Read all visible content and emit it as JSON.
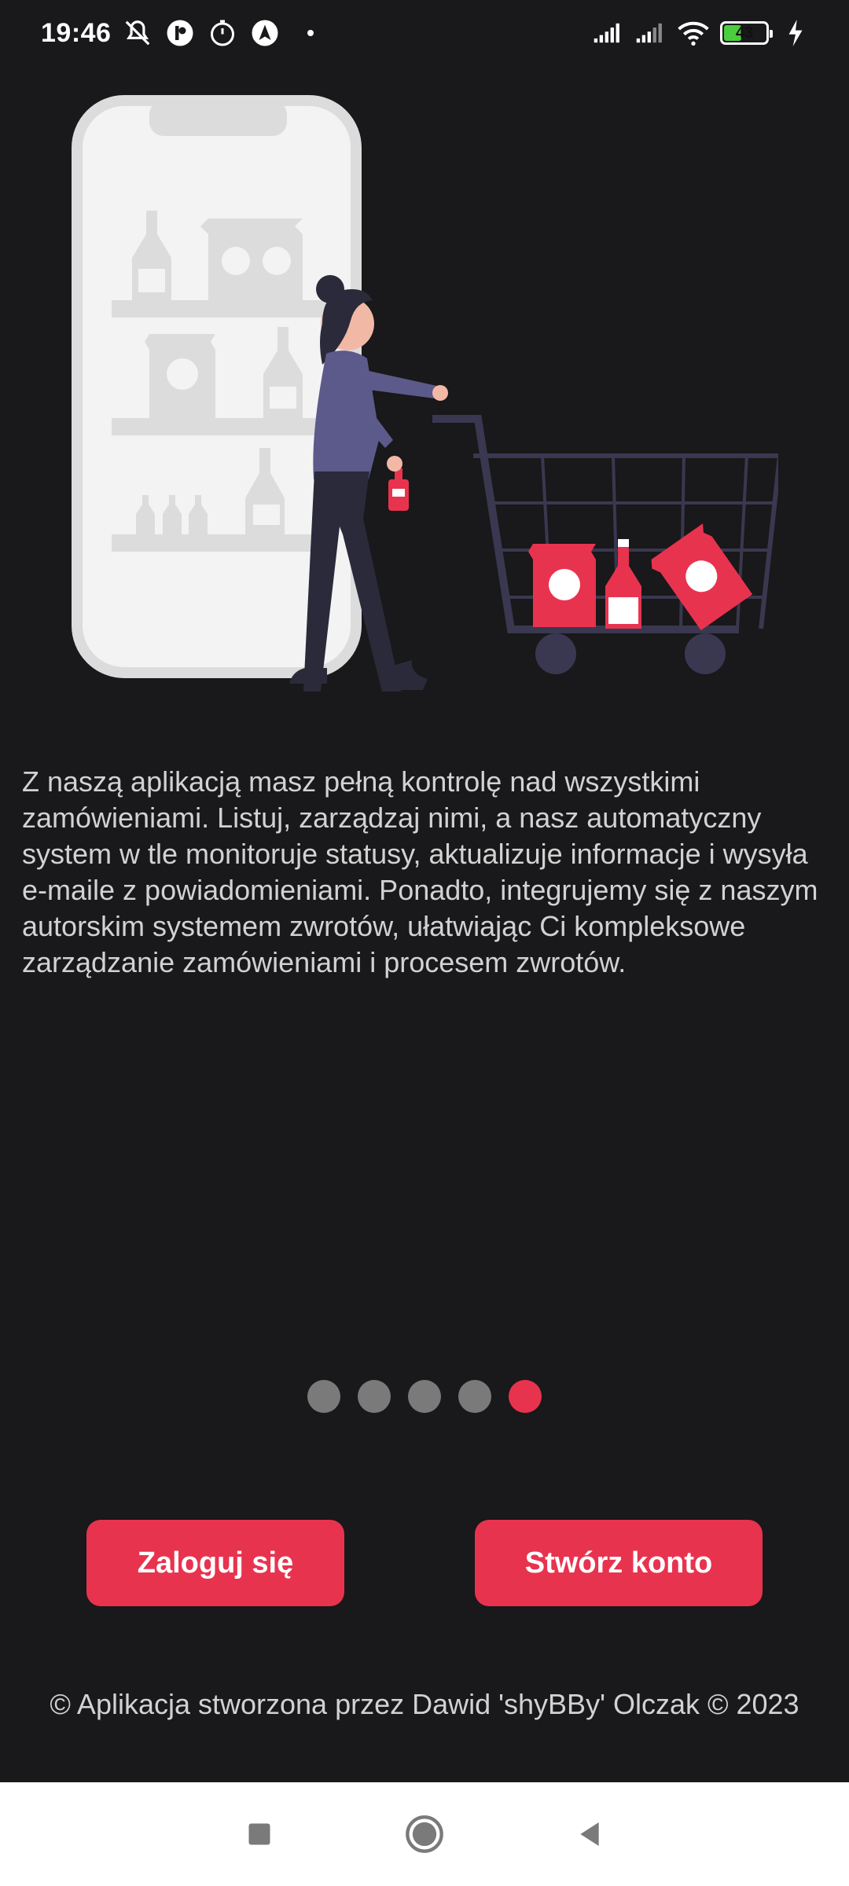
{
  "status_bar": {
    "time": "19:46",
    "battery_level": "43",
    "icons": [
      "mute-icon",
      "app-icon",
      "timer-icon",
      "navigation-icon",
      "signal-icon",
      "signal-icon",
      "wifi-icon",
      "battery-icon",
      "charging-icon"
    ]
  },
  "illustration": {
    "name": "shopping-cart-illustration",
    "accent_color": "#e8334f",
    "phone_color": "#f2f2f2"
  },
  "description": "Z naszą aplikacją masz pełną kontrolę nad wszystkimi zamówieniami. Listuj, zarządzaj nimi, a nasz automatyczny system w tle monitoruje statusy, aktualizuje informacje i wysyła e-maile z powiadomieniami. Ponadto, integrujemy się z naszym autorskim systemem zwrotów, ułatwiając Ci kompleksowe zarządzanie zamówieniami i procesem zwrotów.",
  "pager": {
    "total": 5,
    "active_index": 4
  },
  "buttons": {
    "login_label": "Zaloguj się",
    "register_label": "Stwórz konto"
  },
  "footer": "© Aplikacja stworzona przez Dawid 'shyBBy' Olczak © 2023",
  "colors": {
    "background": "#19181a",
    "accent": "#e8334f",
    "dot_inactive": "#7a7a7a"
  }
}
